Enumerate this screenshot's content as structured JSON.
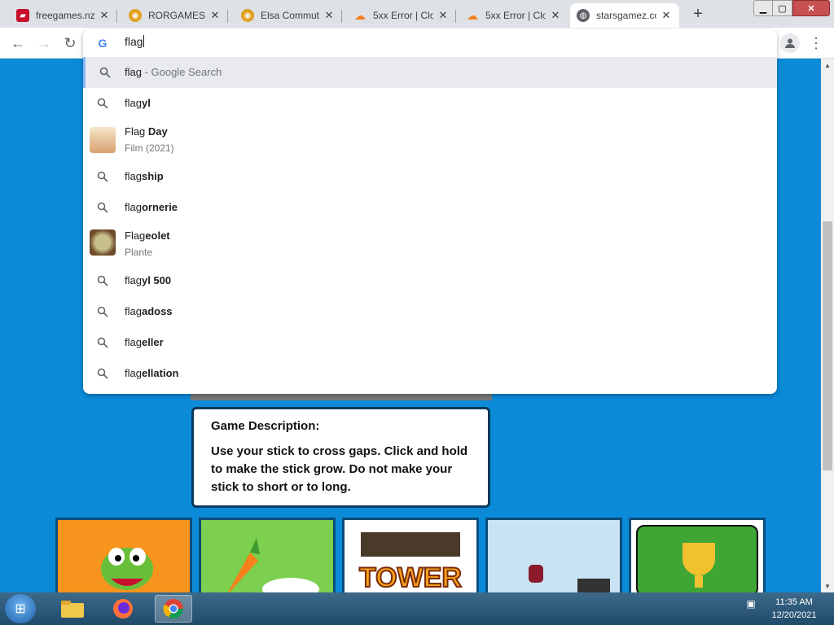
{
  "tabs": [
    {
      "title": "freegames.nz",
      "favicon": "gamepad-icon",
      "color": "#c8102e"
    },
    {
      "title": "RORGAMES",
      "favicon": "coin-icon",
      "color": "#e0a020"
    },
    {
      "title": "Elsa Commute",
      "favicon": "coin-icon",
      "color": "#e0a020"
    },
    {
      "title": "5xx Error | Clo",
      "favicon": "cloud-icon",
      "color": "#f38020"
    },
    {
      "title": "5xx Error | Clo",
      "favicon": "cloud-icon",
      "color": "#f38020"
    },
    {
      "title": "starsgamez.co",
      "favicon": "globe-icon",
      "color": "#5f6368"
    }
  ],
  "omnibox": {
    "typed": "flag",
    "suggestions": [
      {
        "prefix": "flag",
        "bold": "",
        "suffix": " - Google Search",
        "kind": "search",
        "selected": true
      },
      {
        "prefix": "flag",
        "bold": "yl",
        "kind": "search"
      },
      {
        "prefix": "Flag ",
        "bold": "Day",
        "desc": "Film (2021)",
        "kind": "entity"
      },
      {
        "prefix": "flag",
        "bold": "ship",
        "kind": "search"
      },
      {
        "prefix": "flag",
        "bold": "ornerie",
        "kind": "search"
      },
      {
        "prefix": "Flag",
        "bold": "eolet",
        "desc": "Plante",
        "kind": "entity"
      },
      {
        "prefix": "flag",
        "bold": "yl 500",
        "kind": "search"
      },
      {
        "prefix": "flag",
        "bold": "adoss",
        "kind": "search"
      },
      {
        "prefix": "flag",
        "bold": "eller",
        "kind": "search"
      },
      {
        "prefix": "flag",
        "bold": "ellation",
        "kind": "search"
      }
    ]
  },
  "game_description": {
    "title": "Game Description:",
    "text": "Use your stick to cross gaps. Click and hold to make the stick grow. Do not make your stick to short or to long."
  },
  "thumbnails": [
    {
      "name": "snake-game-thumbnail",
      "color": "#f7941d"
    },
    {
      "name": "bunny-carrot-thumbnail",
      "color": "#7ccf4f"
    },
    {
      "name": "tower-game-thumbnail",
      "color": "#ffffff",
      "label": "TOWER"
    },
    {
      "name": "sky-game-thumbnail",
      "color": "#c9e3f5"
    },
    {
      "name": "trophy-game-thumbnail",
      "color": "#3fa534"
    }
  ],
  "taskbar": {
    "time": "11:35 AM",
    "date": "12/20/2021"
  }
}
